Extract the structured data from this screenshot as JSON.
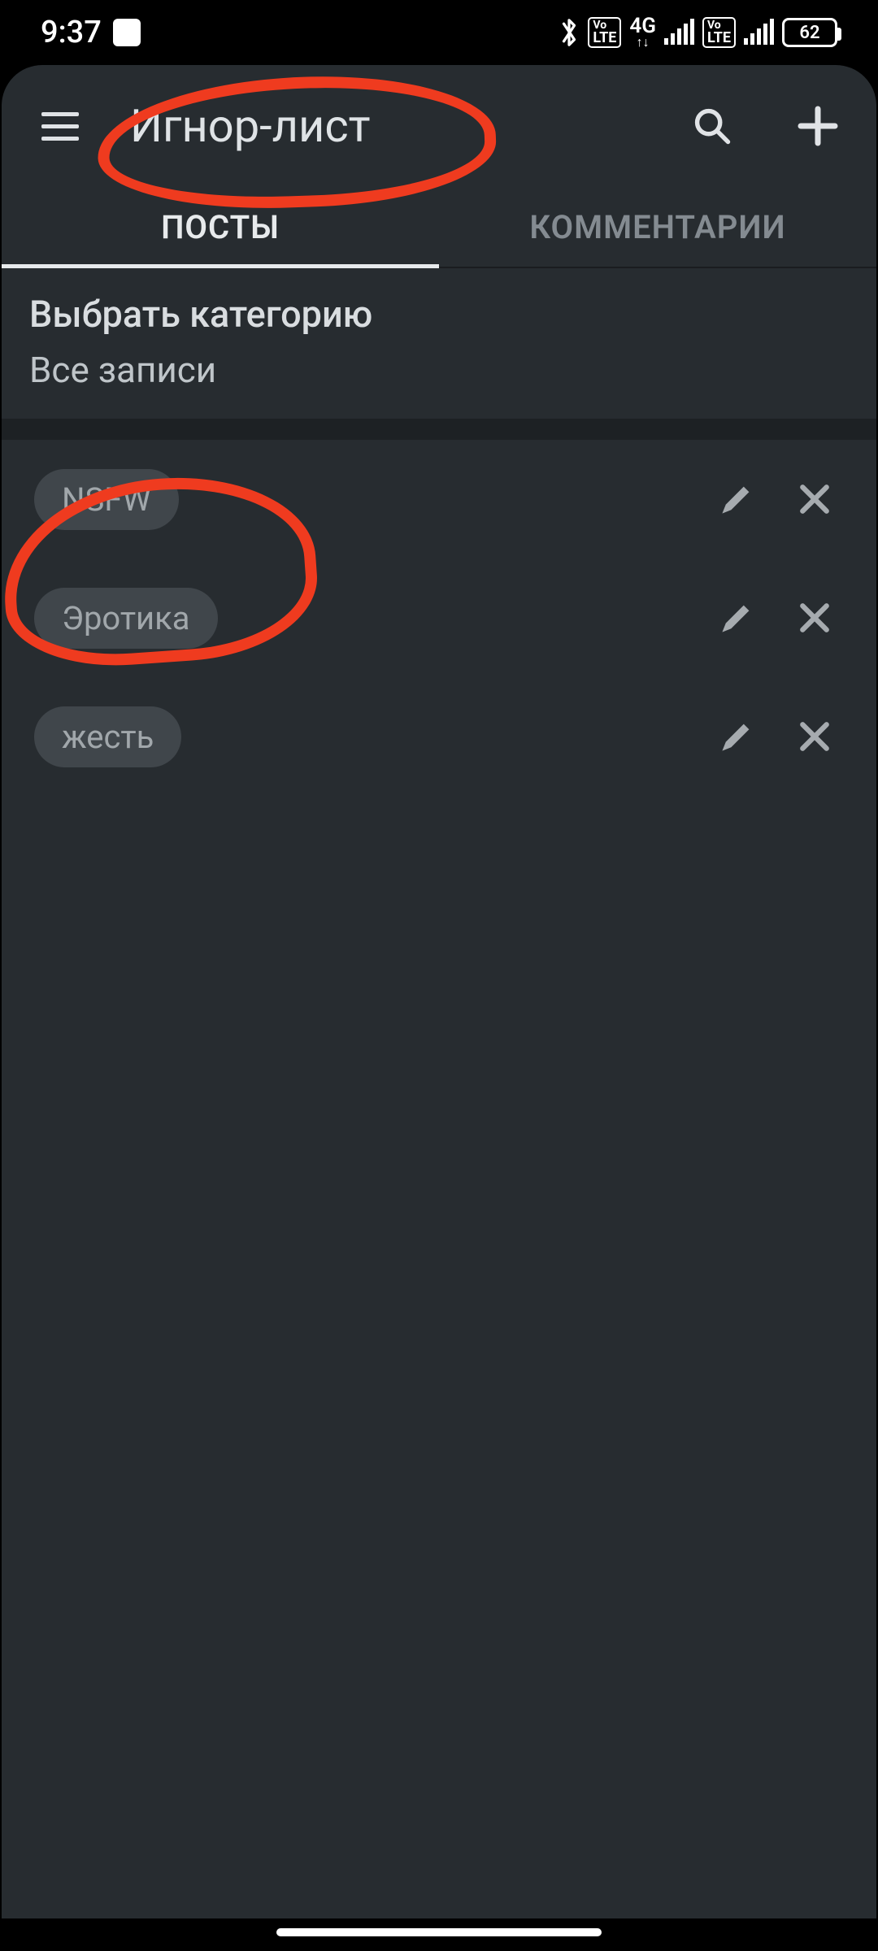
{
  "statusbar": {
    "time": "9:37",
    "battery": "62",
    "volte1": "Vo LTE",
    "net": "4G",
    "volte2": "Vo LTE"
  },
  "header": {
    "title": "Игнор-лист"
  },
  "tabs": {
    "items": [
      {
        "label": "ПОСТЫ",
        "active": true
      },
      {
        "label": "КОММЕНТАРИИ",
        "active": false
      }
    ]
  },
  "category": {
    "title": "Выбрать категорию",
    "value": "Все записи"
  },
  "list": {
    "items": [
      {
        "tag": "NSFW"
      },
      {
        "tag": "Эротика"
      },
      {
        "tag": "жесть"
      }
    ]
  },
  "icons": {
    "search": "search-icon",
    "add": "plus-icon",
    "menu": "hamburger-icon",
    "edit": "pencil-icon",
    "remove": "close-icon",
    "bluetooth": "bluetooth-icon"
  }
}
